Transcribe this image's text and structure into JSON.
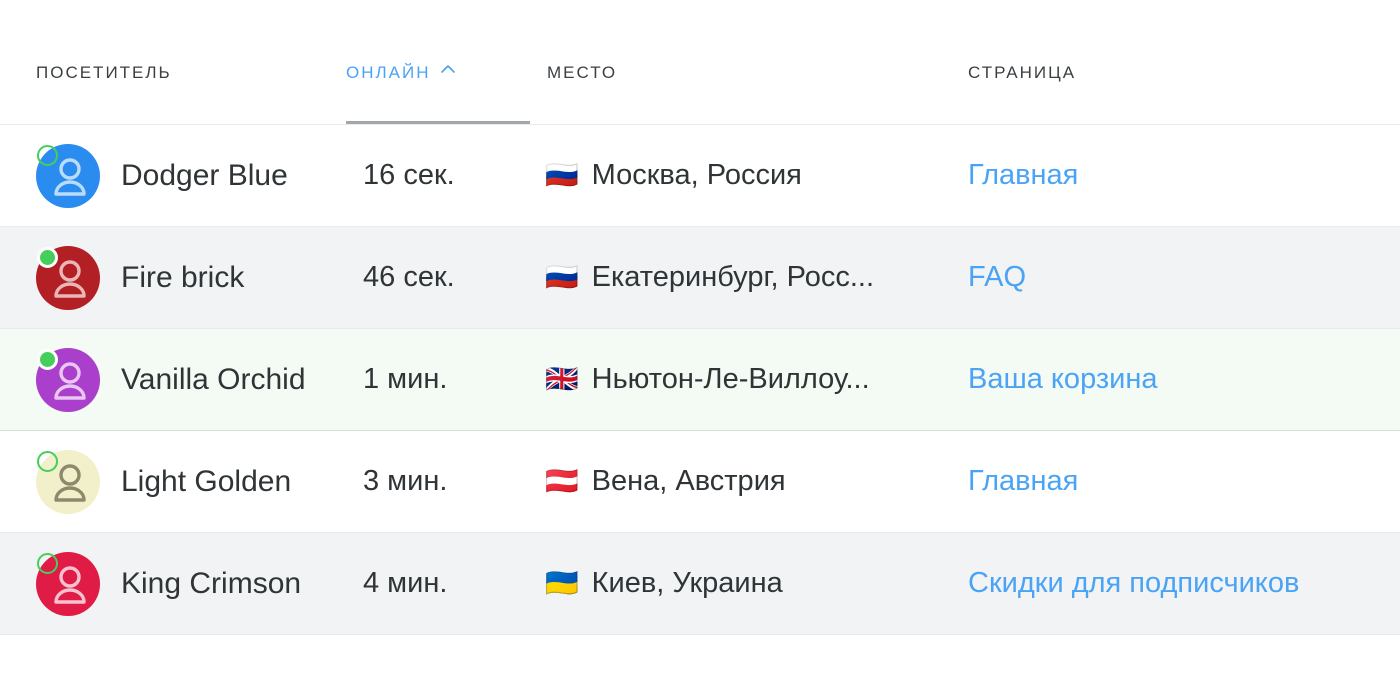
{
  "table": {
    "columns": [
      {
        "key": "visitor",
        "label": "ПОСЕТИТЕЛЬ"
      },
      {
        "key": "online",
        "label": "ОНЛАЙН",
        "sorted": true,
        "sort_direction": "asc",
        "sort_icon": "chevron-up-icon"
      },
      {
        "key": "place",
        "label": "МЕСТО"
      },
      {
        "key": "page",
        "label": "СТРАНИЦА"
      }
    ],
    "rows": [
      {
        "visitor": "Dodger Blue",
        "online": "16 сек.",
        "flag": "🇷🇺",
        "flag_name": "flag-russia",
        "place": "Москва, Россия",
        "page": "Главная",
        "avatar_color": "#2b8cf0",
        "avatar_glyph_color": "#b9dcfb",
        "status": "ring",
        "row_style": "plain"
      },
      {
        "visitor": "Fire brick",
        "online": "46 сек.",
        "flag": "🇷🇺",
        "flag_name": "flag-russia",
        "place": "Екатеринбург, Росс...",
        "page": "FAQ",
        "avatar_color": "#b21f24",
        "avatar_glyph_color": "#eab6b6",
        "status": "solid",
        "row_style": "alt"
      },
      {
        "visitor": "Vanilla Orchid",
        "online": "1 мин.",
        "flag": "🇬🇧",
        "flag_name": "flag-united-kingdom",
        "place": "Ньютон-Ле-Виллоу...",
        "page": "Ваша корзина",
        "avatar_color": "#a93fcb",
        "avatar_glyph_color": "#e9c7f2",
        "status": "solid",
        "row_style": "highlight"
      },
      {
        "visitor": "Light Golden",
        "online": "3 мин.",
        "flag": "🇦🇹",
        "flag_name": "flag-austria",
        "place": "Вена, Австрия",
        "page": "Главная",
        "avatar_color": "#f2f0cb",
        "avatar_glyph_color": "#8d8a6c",
        "status": "ring",
        "row_style": "plain"
      },
      {
        "visitor": "King Crimson",
        "online": "4 мин.",
        "flag": "🇺🇦",
        "flag_name": "flag-ukraine",
        "place": "Киев, Украина",
        "page": "Скидки для подписчиков",
        "avatar_color": "#e01b45",
        "avatar_glyph_color": "#f6c2cf",
        "status": "ring",
        "row_style": "alt"
      }
    ]
  },
  "colors": {
    "accent_link": "#4aa3f5",
    "status_online": "#45cf5a",
    "text_primary": "#2f3437",
    "row_alt_bg": "#f1f3f5",
    "row_highlight_bg": "#f4faf4",
    "border": "#e9ebed"
  }
}
